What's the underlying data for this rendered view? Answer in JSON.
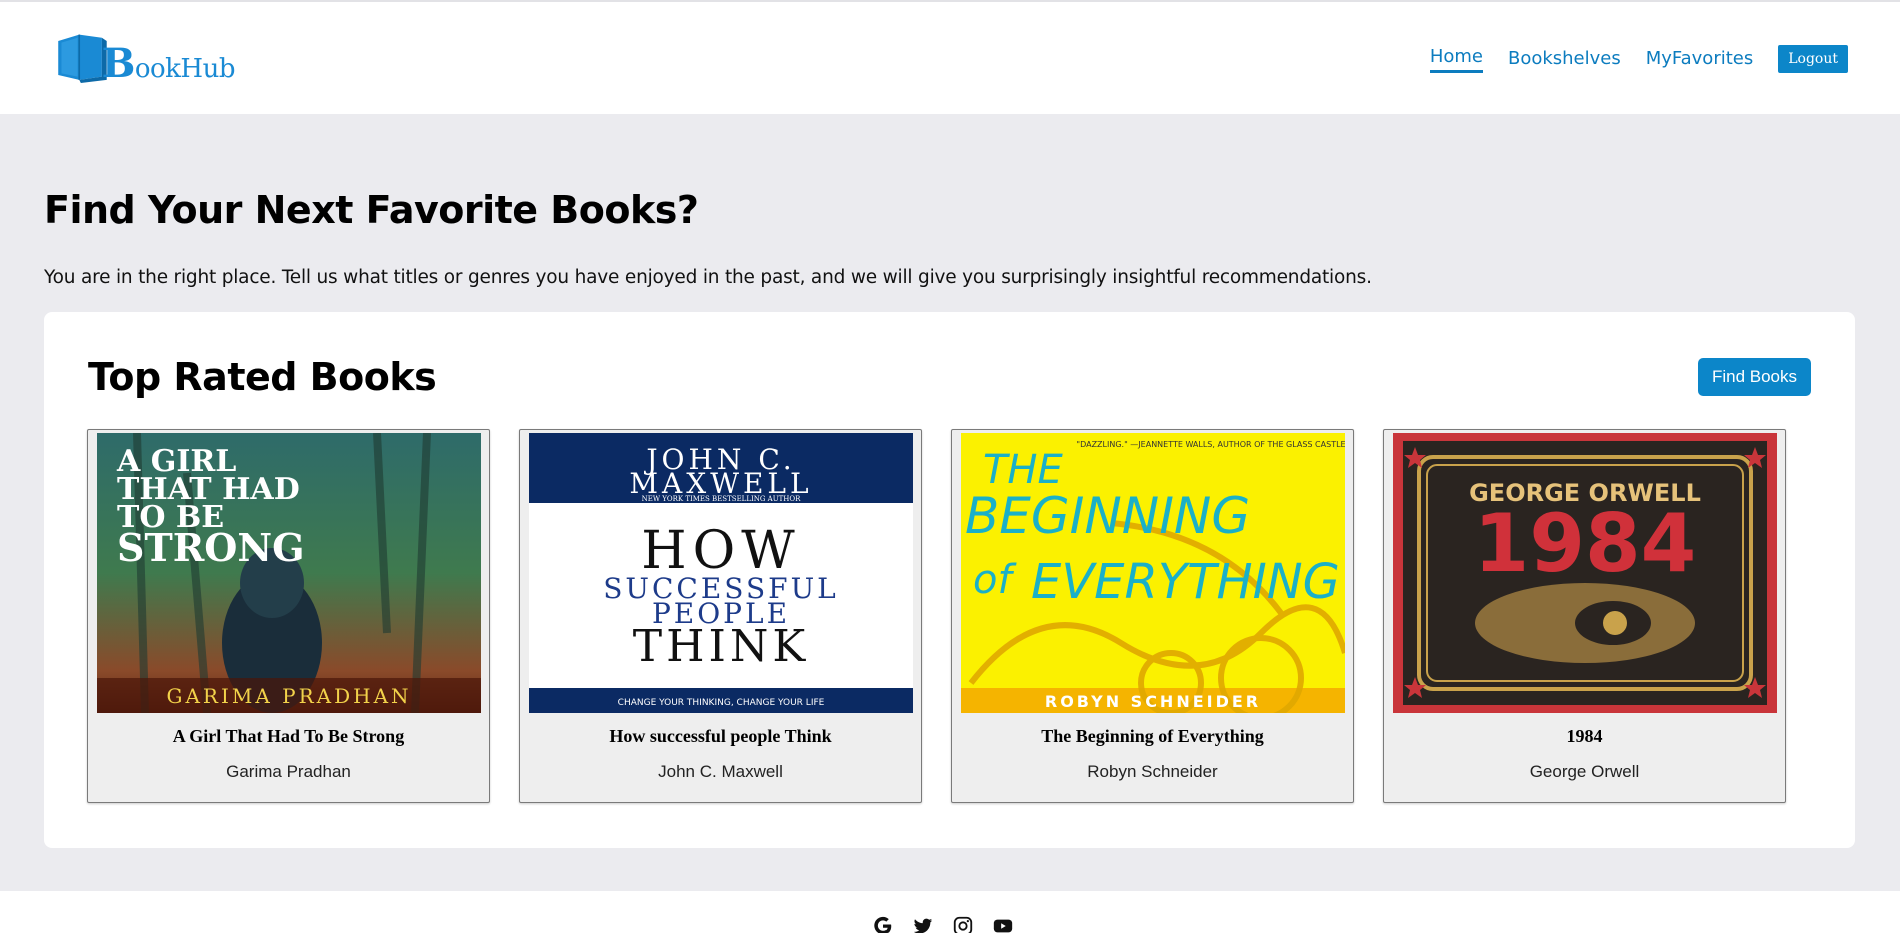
{
  "header": {
    "logo_text": "ookHub",
    "logo_initial": "B",
    "nav": [
      {
        "label": "Home",
        "active": true
      },
      {
        "label": "Bookshelves",
        "active": false
      },
      {
        "label": "MyFavorites",
        "active": false
      }
    ],
    "logout_label": "Logout"
  },
  "hero": {
    "title": "Find Your Next Favorite Books?",
    "description": "You are in the right place. Tell us what titles or genres you have enjoyed in the past, and we will give you surprisingly insightful recommendations."
  },
  "top_rated": {
    "title": "Top Rated Books",
    "find_button": "Find Books",
    "books": [
      {
        "title": "A Girl That Had To Be Strong",
        "author": "Garima Pradhan",
        "cover_lines": [
          "A GIRL",
          "THAT HAD",
          "TO BE",
          "STRONG"
        ],
        "cover_author": "GARIMA  PRADHAN"
      },
      {
        "title": "How successful people Think",
        "author": "John C. Maxwell",
        "cover_author_lines": [
          "JOHN C.",
          "MAXWELL"
        ],
        "cover_tagline": "NEW YORK TIMES BESTSELLING AUTHOR",
        "cover_lines": [
          "HOW",
          "SUCCESSFUL",
          "PEOPLE",
          "THINK"
        ],
        "cover_subtitle": "CHANGE YOUR THINKING, CHANGE YOUR LIFE"
      },
      {
        "title": "The Beginning of Everything",
        "author": "Robyn Schneider",
        "cover_quote": "\"DAZZLING.\" —JEANNETTE WALLS, AUTHOR OF THE GLASS CASTLE",
        "cover_lines": [
          "THE",
          "BEGINNING",
          "of",
          "EVERYTHING"
        ],
        "cover_author": "ROBYN SCHNEIDER"
      },
      {
        "title": "1984",
        "author": "George Orwell",
        "cover_author": "GEORGE ORWELL",
        "cover_title": "1984"
      }
    ]
  },
  "footer": {
    "social": [
      "google-icon",
      "twitter-icon",
      "instagram-icon",
      "youtube-icon"
    ]
  },
  "colors": {
    "accent": "#0c86c9",
    "link": "#0c7cbf",
    "page_bg": "#ebebef"
  }
}
